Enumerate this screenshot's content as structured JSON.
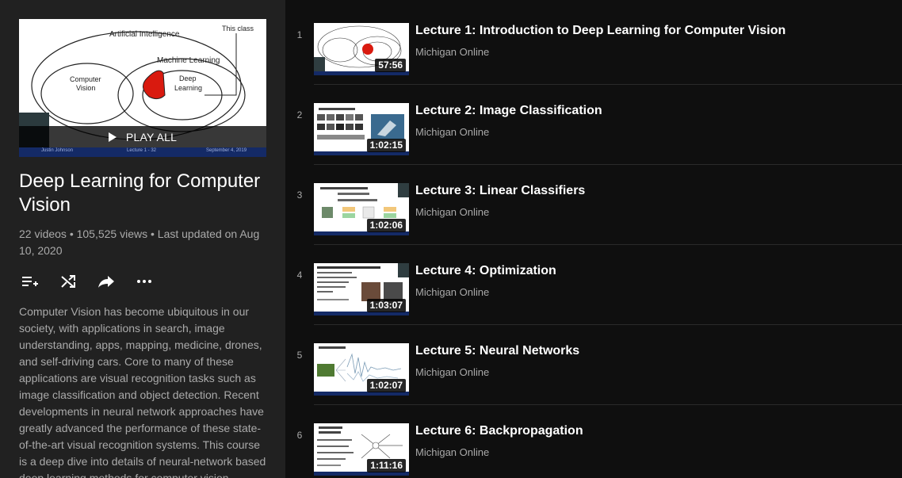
{
  "playlist": {
    "hero": {
      "diagram": {
        "outer": "Artificial Intelligence",
        "cv": "Computer Vision",
        "ml": "Machine Learning",
        "dl": "Deep Learning",
        "cls": "This class"
      },
      "footer_left": "Justin Johnson",
      "footer_mid": "Lecture 1 - 32",
      "footer_right": "September 4, 2019"
    },
    "play_all_label": "PLAY ALL",
    "title": "Deep Learning for Computer Vision",
    "stats": "22 videos • 105,525 views • Last updated on Aug 10, 2020",
    "description": "Computer Vision has become ubiquitous in our society, with applications in search, image understanding, apps, mapping, medicine, drones, and self-driving cars. Core to many of these applications are visual recognition tasks such as image classification and object detection. Recent developments in neural network approaches have greatly advanced the performance of these state-of-the-art visual recognition systems. This course is a deep dive into details of neural-network based deep learning methods for computer vision."
  },
  "actions": {
    "add_to_queue_icon": "playlist-add-icon",
    "shuffle_icon": "shuffle-icon",
    "share_icon": "share-icon",
    "more_icon": "more-horiz-icon"
  },
  "colors": {
    "background": "#0f0f0f",
    "sidebar": "#212121",
    "text_secondary": "#aaaaaa",
    "slide_footer": "#142a66"
  },
  "videos": [
    {
      "index": "1",
      "title": "Lecture 1: Introduction to Deep Learning for Computer Vision",
      "channel": "Michigan Online",
      "duration": "57:56"
    },
    {
      "index": "2",
      "title": "Lecture 2: Image Classification",
      "channel": "Michigan Online",
      "duration": "1:02:15"
    },
    {
      "index": "3",
      "title": "Lecture 3: Linear Classifiers",
      "channel": "Michigan Online",
      "duration": "1:02:06"
    },
    {
      "index": "4",
      "title": "Lecture 4: Optimization",
      "channel": "Michigan Online",
      "duration": "1:03:07"
    },
    {
      "index": "5",
      "title": "Lecture 5: Neural Networks",
      "channel": "Michigan Online",
      "duration": "1:02:07"
    },
    {
      "index": "6",
      "title": "Lecture 6: Backpropagation",
      "channel": "Michigan Online",
      "duration": "1:11:16"
    }
  ]
}
